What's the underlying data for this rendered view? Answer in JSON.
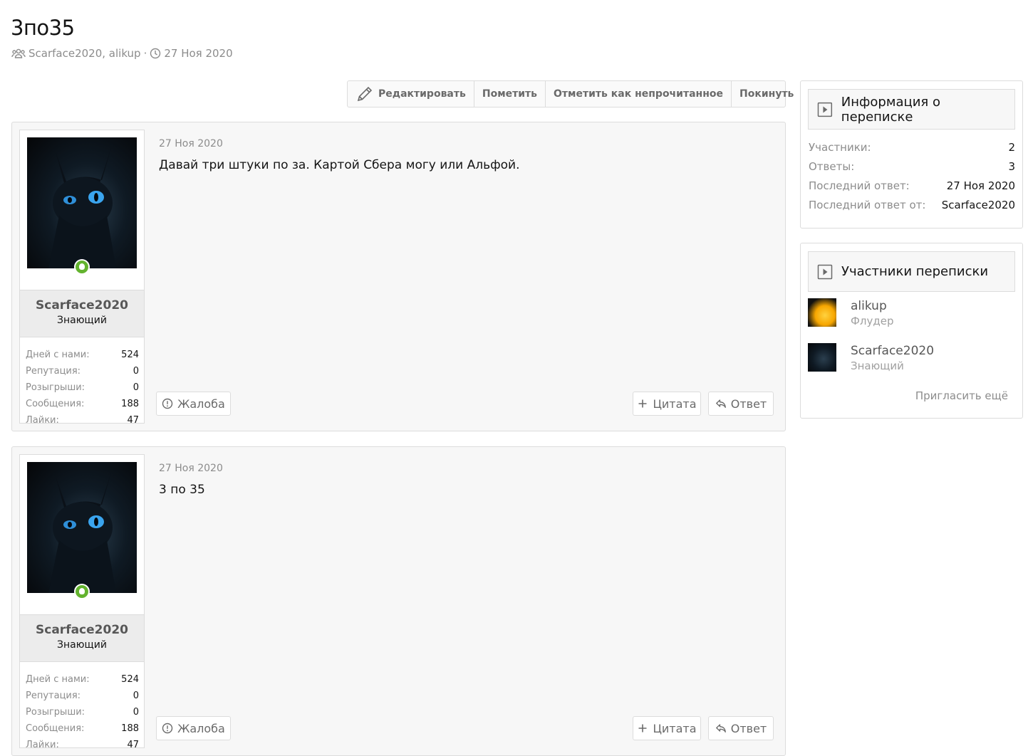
{
  "conversation": {
    "title": "3по35",
    "participants_line": "Scarface2020, alikup",
    "separator": "·",
    "date": "27 Ноя 2020"
  },
  "toolbar": {
    "edit_label": "Редактировать",
    "mark_label": "Пометить",
    "unread_label": "Отметить как непрочитанное",
    "leave_label": "Покинуть"
  },
  "messages": [
    {
      "username": "Scarface2020",
      "user_title": "Знающий",
      "stats": [
        {
          "label": "Дней с нами:",
          "value": "524"
        },
        {
          "label": "Репутация:",
          "value": "0"
        },
        {
          "label": "Розыгрыши:",
          "value": "0"
        },
        {
          "label": "Сообщения:",
          "value": "188"
        },
        {
          "label": "Лайки:",
          "value": "47"
        }
      ],
      "date": "27 Ноя 2020",
      "text": "Давай три штуки по за. Картой Сбера могу или Альфой.",
      "report_label": "Жалоба",
      "quote_label": "Цитата",
      "reply_label": "Ответ"
    },
    {
      "username": "Scarface2020",
      "user_title": "Знающий",
      "stats": [
        {
          "label": "Дней с нами:",
          "value": "524"
        },
        {
          "label": "Репутация:",
          "value": "0"
        },
        {
          "label": "Розыгрыши:",
          "value": "0"
        },
        {
          "label": "Сообщения:",
          "value": "188"
        },
        {
          "label": "Лайки:",
          "value": "47"
        }
      ],
      "date": "27 Ноя 2020",
      "text": "3 по 35",
      "report_label": "Жалоба",
      "quote_label": "Цитата",
      "reply_label": "Ответ"
    }
  ],
  "sidebar": {
    "info": {
      "heading": "Информация о переписке",
      "rows": [
        {
          "label": "Участники:",
          "value": "2"
        },
        {
          "label": "Ответы:",
          "value": "3"
        },
        {
          "label": "Последний ответ:",
          "value": "27 Ноя 2020"
        },
        {
          "label": "Последний ответ от:",
          "value": "Scarface2020"
        }
      ]
    },
    "participants": {
      "heading": "Участники переписки",
      "items": [
        {
          "name": "alikup",
          "title": "Флудер"
        },
        {
          "name": "Scarface2020",
          "title": "Знающий"
        }
      ],
      "invite_label": "Пригласить ещё"
    }
  },
  "colors": {
    "online": "#63b32e",
    "muted": "#8c8c8c",
    "border": "#dcdcdc"
  }
}
